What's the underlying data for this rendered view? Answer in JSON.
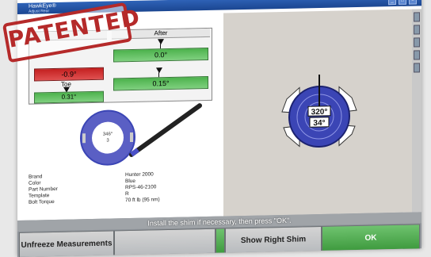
{
  "window": {
    "title": "HawkEye®",
    "menu": "Adjust Rear",
    "controls": [
      "_",
      "□",
      "×"
    ]
  },
  "stamp": "PATENTED",
  "measurements": {
    "after_header": "After",
    "before_toe_label": "Toe",
    "before_camber_value": "-0.9°",
    "before_toe_value": "0.31°",
    "after_camber_value": "0.0°",
    "after_toe_value": "0.15°"
  },
  "shim_image": {
    "inner_angle": "346°",
    "inner_index": "3"
  },
  "specs": [
    {
      "key": "Brand",
      "value": "Hunter 2000"
    },
    {
      "key": "Color",
      "value": "Blue"
    },
    {
      "key": "Part Number",
      "value": "RPS-46-2100"
    },
    {
      "key": "Template",
      "value": "R"
    },
    {
      "key": "Bolt Torque",
      "value": "70 ft lb (95 nm)"
    }
  ],
  "shim_diagram": {
    "angle_label": "320°",
    "index_label": "34°"
  },
  "prompt": "Install the shim if necessary, then press \"OK\".",
  "buttons": {
    "unfreeze": "Unfreeze Measurements",
    "show_shim": "Show Right Shim",
    "ok": "OK"
  },
  "colors": {
    "gauge_green": "#4cb24c",
    "gauge_red": "#c42020",
    "shim_blue": "#3b45b5",
    "ok_green": "#3f9b3f",
    "stamp_red": "#b52a2a"
  }
}
